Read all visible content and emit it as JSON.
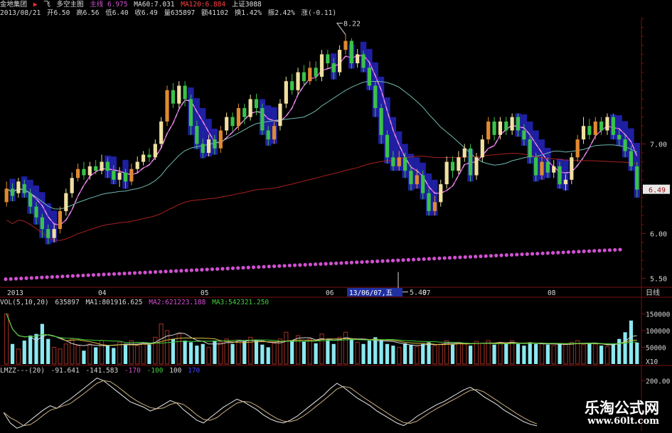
{
  "header": {
    "stock_name": "金地集团",
    "tab_feixiang": "飞",
    "tab_duokong": "多空主图",
    "tab_zhuxian": "主线 6.975",
    "ma60": "MA60:7.031",
    "ma120": "MA120:6.884",
    "shangzheng": "上证3088",
    "date": "2013/08/21",
    "open": "开6.50",
    "high": "高6.56",
    "low": "低6.40",
    "close": "收6.49",
    "volume": "量635897",
    "amount": "额41102",
    "turnover": "换1.42%",
    "amplitude": "振2.42%",
    "change": "涨(-0.11)"
  },
  "price_axis": {
    "ticks": [
      "7.00",
      "6.00",
      "5.50"
    ],
    "current_value": "6.49",
    "high_mark": "8.22",
    "low_mark": "5.49"
  },
  "time_axis": {
    "labels": [
      "2013",
      "04",
      "05",
      "06",
      "07",
      "08"
    ],
    "cursor_label": "13/06/07,五",
    "period": "日线"
  },
  "vol_panel": {
    "title": "VOL(5,10,20)",
    "vol": "635897",
    "ma1": "MA1:801916.625",
    "ma2": "MA2:621223.188",
    "ma3": "MA3:542321.250",
    "ticks": [
      "150000",
      "100000",
      "50000"
    ],
    "unit": "X10"
  },
  "lmzz_panel": {
    "title": "LMZZ---(20)",
    "v1": "-91.641",
    "v2": "-141.583",
    "l1": "-170",
    "l2": "-100",
    "l3": "100",
    "l4": "170",
    "tick": "200.00"
  },
  "watermark": {
    "title": "乐淘公式网",
    "url": "www.60lt.com"
  },
  "colors": {
    "up": "#e08a30",
    "up_light": "#f0e0a0",
    "down": "#39c24a",
    "vol_down": "#8be8f0",
    "vol_up": "#8a2a20",
    "ma_white": "#d8d8d8",
    "ma_teal": "#70b8b0",
    "ma_red": "#a82020",
    "dots": "#d050d0",
    "band": "#2a2ad8",
    "axis": "#7a1010"
  },
  "chart_data": {
    "type": "candlestick",
    "price_ylim": [
      5.4,
      8.4
    ],
    "price_ticks": [
      5.5,
      6.0,
      7.0
    ],
    "current_price": 6.49,
    "annotations": [
      {
        "label": "8.22",
        "value": 8.22
      },
      {
        "label": "5.49",
        "value": 5.49
      }
    ],
    "candles": [
      {
        "o": 6.35,
        "c": 6.5,
        "h": 6.58,
        "l": 6.3
      },
      {
        "o": 6.5,
        "c": 6.42,
        "h": 6.56,
        "l": 6.36
      },
      {
        "o": 6.45,
        "c": 6.58,
        "h": 6.62,
        "l": 6.4
      },
      {
        "o": 6.55,
        "c": 6.45,
        "h": 6.6,
        "l": 6.4
      },
      {
        "o": 6.45,
        "c": 6.3,
        "h": 6.5,
        "l": 6.22
      },
      {
        "o": 6.3,
        "c": 6.18,
        "h": 6.35,
        "l": 6.1
      },
      {
        "o": 6.18,
        "c": 6.05,
        "h": 6.22,
        "l": 5.95
      },
      {
        "o": 6.05,
        "c": 5.95,
        "h": 6.1,
        "l": 5.88
      },
      {
        "o": 5.95,
        "c": 6.05,
        "h": 6.1,
        "l": 5.9
      },
      {
        "o": 6.05,
        "c": 6.25,
        "h": 6.3,
        "l": 6.0
      },
      {
        "o": 6.25,
        "c": 6.45,
        "h": 6.5,
        "l": 6.2
      },
      {
        "o": 6.45,
        "c": 6.62,
        "h": 6.68,
        "l": 6.4
      },
      {
        "o": 6.62,
        "c": 6.72,
        "h": 6.78,
        "l": 6.58
      },
      {
        "o": 6.72,
        "c": 6.65,
        "h": 6.8,
        "l": 6.6
      },
      {
        "o": 6.65,
        "c": 6.75,
        "h": 6.8,
        "l": 6.6
      },
      {
        "o": 6.75,
        "c": 6.7,
        "h": 6.82,
        "l": 6.66
      },
      {
        "o": 6.7,
        "c": 6.8,
        "h": 6.88,
        "l": 6.66
      },
      {
        "o": 6.8,
        "c": 6.7,
        "h": 6.85,
        "l": 6.62
      },
      {
        "o": 6.7,
        "c": 6.6,
        "h": 6.76,
        "l": 6.55
      },
      {
        "o": 6.6,
        "c": 6.68,
        "h": 6.74,
        "l": 6.52
      },
      {
        "o": 6.68,
        "c": 6.58,
        "h": 6.72,
        "l": 6.5
      },
      {
        "o": 6.58,
        "c": 6.72,
        "h": 6.78,
        "l": 6.54
      },
      {
        "o": 6.72,
        "c": 6.8,
        "h": 6.86,
        "l": 6.68
      },
      {
        "o": 6.8,
        "c": 6.88,
        "h": 6.92,
        "l": 6.76
      },
      {
        "o": 6.88,
        "c": 6.85,
        "h": 6.95,
        "l": 6.8
      },
      {
        "o": 6.85,
        "c": 7.0,
        "h": 7.05,
        "l": 6.82
      },
      {
        "o": 7.0,
        "c": 7.25,
        "h": 7.3,
        "l": 6.96
      },
      {
        "o": 7.25,
        "c": 7.6,
        "h": 7.65,
        "l": 7.2
      },
      {
        "o": 7.6,
        "c": 7.45,
        "h": 7.68,
        "l": 7.4
      },
      {
        "o": 7.45,
        "c": 7.65,
        "h": 7.7,
        "l": 7.4
      },
      {
        "o": 7.65,
        "c": 7.5,
        "h": 7.7,
        "l": 7.42
      },
      {
        "o": 7.5,
        "c": 7.2,
        "h": 7.55,
        "l": 7.1
      },
      {
        "o": 7.2,
        "c": 7.0,
        "h": 7.26,
        "l": 6.94
      },
      {
        "o": 7.0,
        "c": 6.9,
        "h": 7.06,
        "l": 6.84
      },
      {
        "o": 6.9,
        "c": 7.05,
        "h": 7.1,
        "l": 6.86
      },
      {
        "o": 7.05,
        "c": 6.95,
        "h": 7.1,
        "l": 6.88
      },
      {
        "o": 6.95,
        "c": 7.15,
        "h": 7.2,
        "l": 6.9
      },
      {
        "o": 7.15,
        "c": 7.3,
        "h": 7.35,
        "l": 7.1
      },
      {
        "o": 7.3,
        "c": 7.2,
        "h": 7.35,
        "l": 7.14
      },
      {
        "o": 7.2,
        "c": 7.4,
        "h": 7.45,
        "l": 7.15
      },
      {
        "o": 7.4,
        "c": 7.3,
        "h": 7.45,
        "l": 7.22
      },
      {
        "o": 7.3,
        "c": 7.5,
        "h": 7.55,
        "l": 7.26
      },
      {
        "o": 7.5,
        "c": 7.4,
        "h": 7.56,
        "l": 7.32
      },
      {
        "o": 7.4,
        "c": 7.15,
        "h": 7.45,
        "l": 7.1
      },
      {
        "o": 7.15,
        "c": 7.05,
        "h": 7.2,
        "l": 6.98
      },
      {
        "o": 7.05,
        "c": 7.2,
        "h": 7.25,
        "l": 7.0
      },
      {
        "o": 7.2,
        "c": 7.45,
        "h": 7.5,
        "l": 7.15
      },
      {
        "o": 7.45,
        "c": 7.7,
        "h": 7.75,
        "l": 7.4
      },
      {
        "o": 7.7,
        "c": 7.6,
        "h": 7.78,
        "l": 7.55
      },
      {
        "o": 7.6,
        "c": 7.8,
        "h": 7.85,
        "l": 7.55
      },
      {
        "o": 7.8,
        "c": 7.7,
        "h": 7.88,
        "l": 7.64
      },
      {
        "o": 7.7,
        "c": 7.85,
        "h": 7.92,
        "l": 7.66
      },
      {
        "o": 7.85,
        "c": 7.75,
        "h": 7.92,
        "l": 7.7
      },
      {
        "o": 7.75,
        "c": 8.0,
        "h": 8.05,
        "l": 7.7
      },
      {
        "o": 8.0,
        "c": 7.9,
        "h": 8.05,
        "l": 7.84
      },
      {
        "o": 7.9,
        "c": 7.8,
        "h": 7.96,
        "l": 7.72
      },
      {
        "o": 7.8,
        "c": 8.05,
        "h": 8.1,
        "l": 7.76
      },
      {
        "o": 8.05,
        "c": 8.15,
        "h": 8.22,
        "l": 8.0
      },
      {
        "o": 8.15,
        "c": 7.9,
        "h": 8.18,
        "l": 7.84
      },
      {
        "o": 7.9,
        "c": 8.0,
        "h": 8.06,
        "l": 7.85
      },
      {
        "o": 8.0,
        "c": 7.85,
        "h": 8.04,
        "l": 7.8
      },
      {
        "o": 7.85,
        "c": 7.65,
        "h": 7.9,
        "l": 7.6
      },
      {
        "o": 7.65,
        "c": 7.4,
        "h": 7.7,
        "l": 7.3
      },
      {
        "o": 7.4,
        "c": 7.1,
        "h": 7.45,
        "l": 7.0
      },
      {
        "o": 7.1,
        "c": 6.85,
        "h": 7.15,
        "l": 6.78
      },
      {
        "o": 6.85,
        "c": 6.75,
        "h": 6.92,
        "l": 6.7
      },
      {
        "o": 6.75,
        "c": 6.85,
        "h": 6.92,
        "l": 6.7
      },
      {
        "o": 6.85,
        "c": 6.7,
        "h": 6.9,
        "l": 6.62
      },
      {
        "o": 6.7,
        "c": 6.55,
        "h": 6.76,
        "l": 6.48
      },
      {
        "o": 6.55,
        "c": 6.65,
        "h": 6.72,
        "l": 6.5
      },
      {
        "o": 6.65,
        "c": 6.45,
        "h": 6.7,
        "l": 6.38
      },
      {
        "o": 6.45,
        "c": 6.25,
        "h": 6.5,
        "l": 6.2
      },
      {
        "o": 6.25,
        "c": 6.35,
        "h": 6.42,
        "l": 6.2
      },
      {
        "o": 6.35,
        "c": 6.55,
        "h": 6.6,
        "l": 6.3
      },
      {
        "o": 6.55,
        "c": 6.8,
        "h": 6.86,
        "l": 6.5
      },
      {
        "o": 6.8,
        "c": 6.7,
        "h": 6.86,
        "l": 6.62
      },
      {
        "o": 6.7,
        "c": 6.85,
        "h": 6.92,
        "l": 6.66
      },
      {
        "o": 6.85,
        "c": 6.95,
        "h": 7.0,
        "l": 6.8
      },
      {
        "o": 6.95,
        "c": 6.65,
        "h": 7.0,
        "l": 6.58
      },
      {
        "o": 6.65,
        "c": 6.85,
        "h": 6.9,
        "l": 6.6
      },
      {
        "o": 6.85,
        "c": 7.05,
        "h": 7.1,
        "l": 6.8
      },
      {
        "o": 7.05,
        "c": 7.25,
        "h": 7.3,
        "l": 7.0
      },
      {
        "o": 7.25,
        "c": 7.1,
        "h": 7.3,
        "l": 7.04
      },
      {
        "o": 7.1,
        "c": 7.25,
        "h": 7.3,
        "l": 7.05
      },
      {
        "o": 7.25,
        "c": 7.15,
        "h": 7.3,
        "l": 7.1
      },
      {
        "o": 7.15,
        "c": 7.3,
        "h": 7.34,
        "l": 7.1
      },
      {
        "o": 7.3,
        "c": 7.15,
        "h": 7.34,
        "l": 7.08
      },
      {
        "o": 7.15,
        "c": 7.05,
        "h": 7.22,
        "l": 6.98
      },
      {
        "o": 7.05,
        "c": 6.85,
        "h": 7.1,
        "l": 6.78
      },
      {
        "o": 6.85,
        "c": 6.65,
        "h": 6.9,
        "l": 6.58
      },
      {
        "o": 6.65,
        "c": 6.8,
        "h": 6.86,
        "l": 6.6
      },
      {
        "o": 6.8,
        "c": 6.68,
        "h": 6.85,
        "l": 6.62
      },
      {
        "o": 6.68,
        "c": 6.75,
        "h": 6.82,
        "l": 6.62
      },
      {
        "o": 6.75,
        "c": 6.55,
        "h": 6.8,
        "l": 6.5
      },
      {
        "o": 6.55,
        "c": 6.6,
        "h": 6.66,
        "l": 6.48
      },
      {
        "o": 6.6,
        "c": 6.85,
        "h": 6.9,
        "l": 6.55
      },
      {
        "o": 6.85,
        "c": 7.05,
        "h": 7.1,
        "l": 6.8
      },
      {
        "o": 7.05,
        "c": 7.2,
        "h": 7.3,
        "l": 7.0
      },
      {
        "o": 7.2,
        "c": 7.1,
        "h": 7.28,
        "l": 7.05
      },
      {
        "o": 7.1,
        "c": 7.25,
        "h": 7.3,
        "l": 7.05
      },
      {
        "o": 7.25,
        "c": 7.15,
        "h": 7.3,
        "l": 7.1
      },
      {
        "o": 7.15,
        "c": 7.3,
        "h": 7.34,
        "l": 7.1
      },
      {
        "o": 7.3,
        "c": 7.1,
        "h": 7.34,
        "l": 7.05
      },
      {
        "o": 7.1,
        "c": 7.05,
        "h": 7.16,
        "l": 6.98
      },
      {
        "o": 7.05,
        "c": 6.92,
        "h": 7.1,
        "l": 6.85
      },
      {
        "o": 6.92,
        "c": 6.75,
        "h": 6.98,
        "l": 6.7
      },
      {
        "o": 6.75,
        "c": 6.49,
        "h": 6.8,
        "l": 6.4
      }
    ],
    "volume": [
      150,
      60,
      45,
      70,
      85,
      90,
      120,
      75,
      50,
      45,
      60,
      75,
      55,
      40,
      60,
      50,
      70,
      55,
      48,
      65,
      60,
      70,
      55,
      62,
      58,
      80,
      120,
      100,
      75,
      90,
      70,
      65,
      55,
      60,
      50,
      70,
      65,
      75,
      60,
      72,
      68,
      80,
      70,
      58,
      50,
      62,
      75,
      95,
      70,
      85,
      68,
      75,
      62,
      90,
      70,
      60,
      80,
      95,
      75,
      65,
      60,
      70,
      80,
      72,
      60,
      55,
      50,
      62,
      58,
      52,
      60,
      65,
      55,
      60,
      70,
      58,
      65,
      60,
      55,
      68,
      62,
      70,
      58,
      65,
      62,
      70,
      60,
      55,
      65,
      60,
      62,
      58,
      55,
      60,
      58,
      65,
      70,
      58,
      62,
      60,
      55,
      52,
      60,
      75,
      95,
      130,
      64
    ],
    "vol_ylim": [
      0,
      170000
    ],
    "vol_ticks": [
      50000,
      100000,
      150000
    ],
    "lmzz": [
      -40,
      -120,
      -160,
      -140,
      -100,
      -60,
      -20,
      10,
      -10,
      30,
      60,
      100,
      140,
      180,
      220,
      200,
      160,
      120,
      80,
      40,
      20,
      0,
      -30,
      -10,
      20,
      50,
      30,
      -20,
      -60,
      -100,
      -120,
      -80,
      -40,
      0,
      30,
      60,
      40,
      10,
      -20,
      -60,
      -90,
      -110,
      -120,
      -100,
      -70,
      -30,
      10,
      50,
      90,
      140,
      180,
      150,
      110,
      70,
      40,
      10,
      -30,
      -60,
      -90,
      -120,
      -140,
      -110,
      -70,
      -40,
      -10,
      20,
      40,
      70,
      100,
      130,
      150,
      120,
      80,
      50,
      20,
      -20,
      -50,
      -80,
      -110,
      -130,
      -142
    ],
    "lmzz_ylim": [
      -180,
      240
    ],
    "lmzz_ticks": [
      200
    ]
  }
}
